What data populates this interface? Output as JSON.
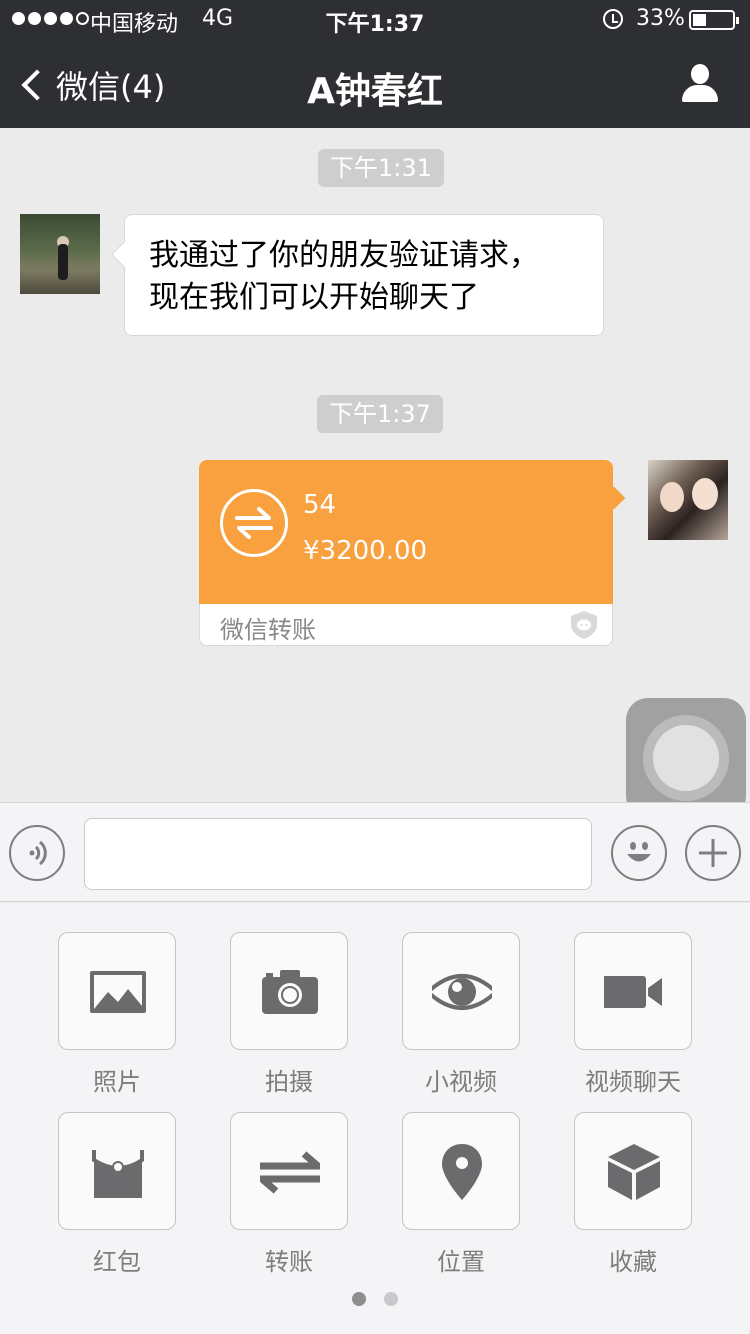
{
  "status_bar": {
    "carrier": "中国移动",
    "network": "4G",
    "time": "下午1:37",
    "battery": "33%",
    "battery_level": 0.33
  },
  "nav": {
    "back_label": "微信(4)",
    "title": "A钟春红"
  },
  "messages": [
    {
      "timestamp": "下午1:31",
      "text_line1": "我通过了你的朋友验证请求，",
      "text_line2": "现在我们可以开始聊天了"
    },
    {
      "timestamp": "下午1:37",
      "transfer": {
        "note": "54",
        "amount": "¥3200.00",
        "label": "微信转账"
      }
    }
  ],
  "input": {
    "value": "",
    "placeholder": ""
  },
  "panel": {
    "items": [
      {
        "label": "照片",
        "icon": "photo-icon"
      },
      {
        "label": "拍摄",
        "icon": "camera-icon"
      },
      {
        "label": "小视频",
        "icon": "eye-icon"
      },
      {
        "label": "视频聊天",
        "icon": "video-camera-icon"
      },
      {
        "label": "红包",
        "icon": "red-envelope-icon"
      },
      {
        "label": "转账",
        "icon": "transfer-icon"
      },
      {
        "label": "位置",
        "icon": "location-pin-icon"
      },
      {
        "label": "收藏",
        "icon": "cube-icon"
      }
    ],
    "pages": 2,
    "current_page": 1
  },
  "colors": {
    "nav_bg": "#2e2f33",
    "transfer_orange": "#f9a03f",
    "icon_gray": "#6b6b6e"
  }
}
